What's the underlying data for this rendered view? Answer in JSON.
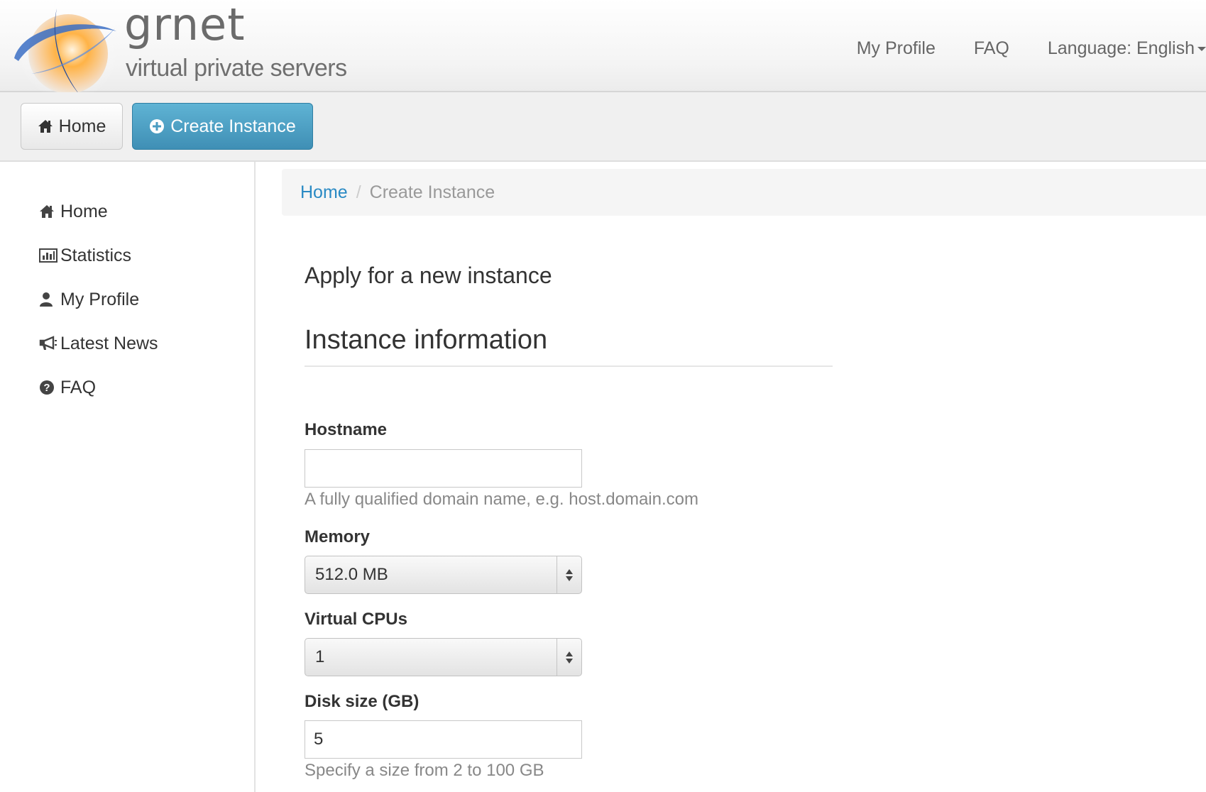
{
  "brand": {
    "name": "grnet",
    "tagline": "virtual private servers"
  },
  "topnav": {
    "my_profile": "My Profile",
    "faq": "FAQ",
    "language": "Language: English"
  },
  "actionbar": {
    "home": "Home",
    "create_instance": "Create Instance"
  },
  "sidebar": {
    "items": [
      {
        "label": "Home",
        "icon": "home-icon"
      },
      {
        "label": "Statistics",
        "icon": "bar-chart-icon"
      },
      {
        "label": "My Profile",
        "icon": "user-icon"
      },
      {
        "label": "Latest News",
        "icon": "bullhorn-icon"
      },
      {
        "label": "FAQ",
        "icon": "question-circle-icon"
      }
    ]
  },
  "breadcrumb": {
    "home": "Home",
    "separator": "/",
    "current": "Create Instance"
  },
  "main": {
    "title": "Apply for a new instance",
    "section_title": "Instance information",
    "fields": {
      "hostname": {
        "label": "Hostname",
        "value": "",
        "help": "A fully qualified domain name, e.g. host.domain.com"
      },
      "memory": {
        "label": "Memory",
        "value": "512.0 MB"
      },
      "vcpus": {
        "label": "Virtual CPUs",
        "value": "1"
      },
      "disk": {
        "label": "Disk size (GB)",
        "value": "5",
        "help": "Specify a size from 2 to 100 GB"
      }
    }
  },
  "colors": {
    "primary_button": "#4a9cc2",
    "link": "#2a8ac4",
    "header_text": "#666666"
  }
}
